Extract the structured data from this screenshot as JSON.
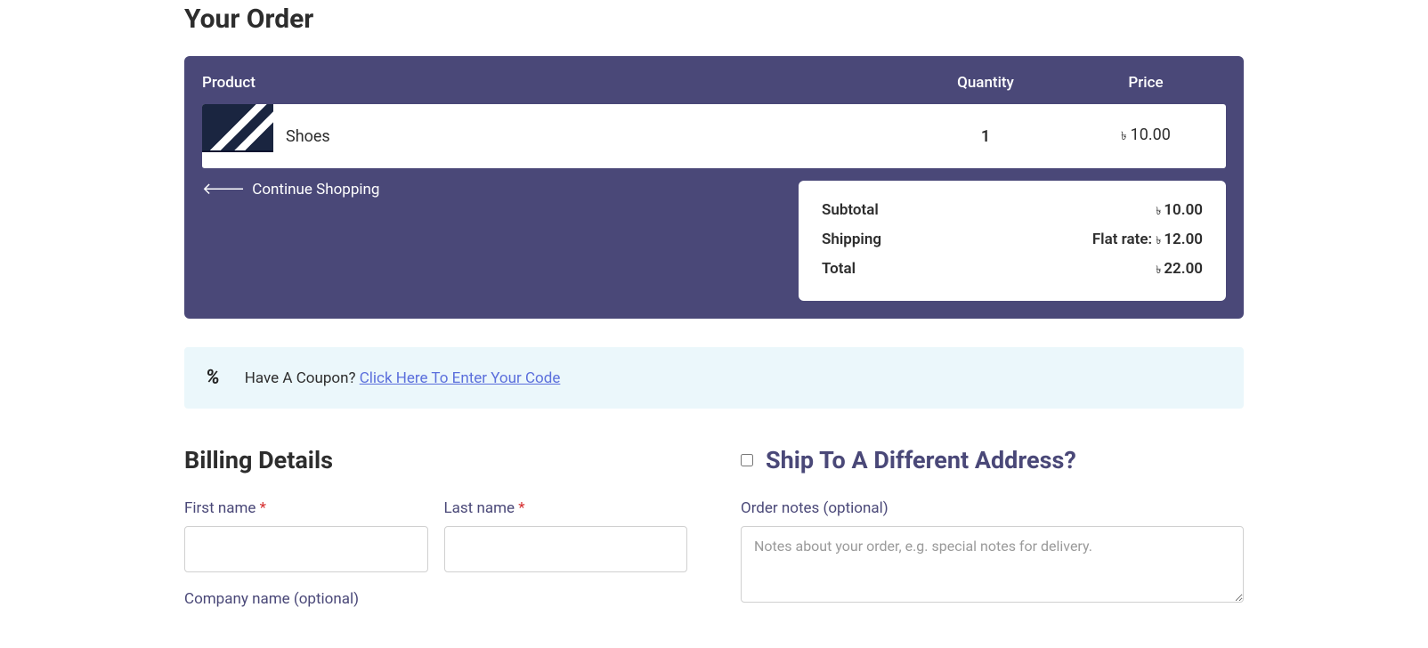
{
  "page_title": "Your Order",
  "order": {
    "headers": {
      "product": "Product",
      "quantity": "Quantity",
      "price": "Price"
    },
    "items": [
      {
        "name": "Shoes",
        "qty": "1",
        "currency": "৳",
        "price": "10.00"
      }
    ],
    "continue_label": "Continue Shopping",
    "totals": {
      "subtotal_label": "Subtotal",
      "subtotal_currency": "৳",
      "subtotal_value": "10.00",
      "shipping_label": "Shipping",
      "shipping_method": "Flat rate:",
      "shipping_currency": "৳",
      "shipping_value": "12.00",
      "total_label": "Total",
      "total_currency": "৳",
      "total_value": "22.00"
    }
  },
  "coupon": {
    "prompt": "Have A Coupon? ",
    "link_text": "Click Here To Enter Your Code"
  },
  "billing": {
    "heading": "Billing Details",
    "first_name_label": "First name ",
    "last_name_label": "Last name ",
    "required_mark": "*",
    "company_label": "Company name (optional)"
  },
  "shipping": {
    "heading": "Ship To A Different Address?",
    "notes_label": "Order notes (optional)",
    "notes_placeholder": "Notes about your order, e.g. special notes for delivery."
  }
}
